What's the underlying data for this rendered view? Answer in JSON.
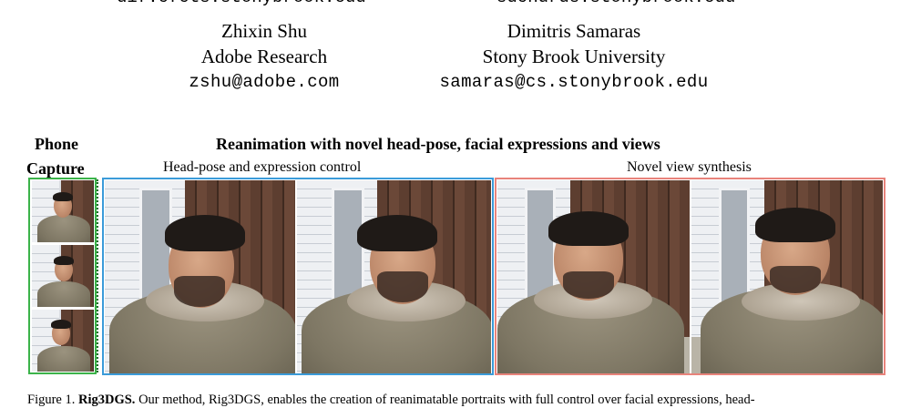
{
  "header_cut": {
    "email_left": "dif.cfcts.stonybrook.edu",
    "email_right": "sdchdrds.stonybrook.edu"
  },
  "authors": [
    {
      "name": "Zhixin Shu",
      "affiliation": "Adobe Research",
      "email": "zshu@adobe.com"
    },
    {
      "name": "Dimitris Samaras",
      "affiliation": "Stony Brook University",
      "email": "samaras@cs.stonybrook.edu"
    }
  ],
  "figure": {
    "left_heading_line1": "Phone",
    "left_heading_line2": "Capture",
    "main_heading": "Reanimation with novel head-pose, facial expressions and views",
    "group_left_label": "Head-pose and expression control",
    "group_right_label": "Novel view synthesis",
    "colors": {
      "green": "#3bb34a",
      "blue": "#3b9bd9",
      "red": "#e8837b"
    }
  },
  "caption": {
    "prefix": "Figure 1.",
    "title": "Rig3DGS.",
    "text": "Our method, Rig3DGS, enables the creation of reanimatable portraits with full control over facial expressions, head-"
  }
}
